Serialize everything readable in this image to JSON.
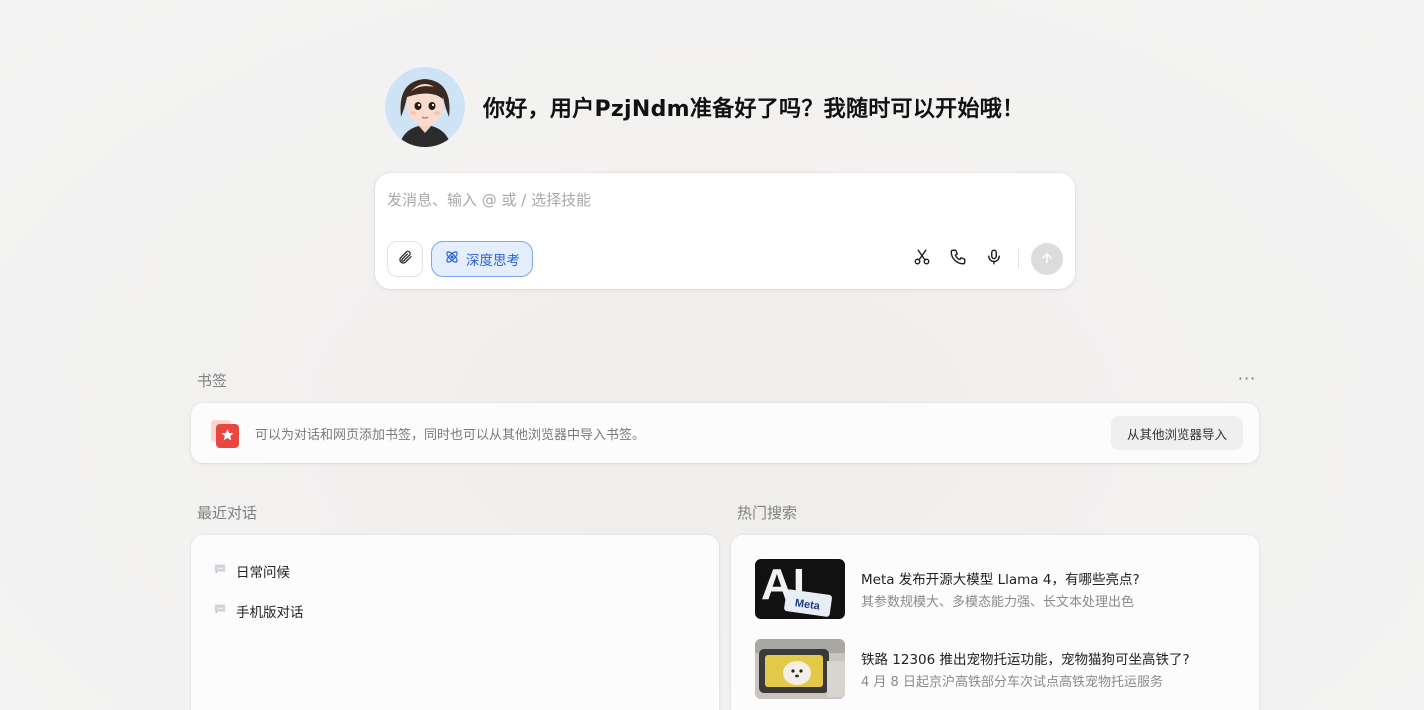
{
  "greeting": "你好，用户PzjNdm准备好了吗？我随时可以开始哦！",
  "composer": {
    "placeholder": "发消息、输入 @ 或 / 选择技能",
    "deep_think_label": "深度思考"
  },
  "icons": {
    "attach": "paperclip-icon",
    "deep_think": "atom-icon",
    "scissors": "scissors-icon",
    "phone": "phone-icon",
    "mic": "microphone-icon",
    "send": "arrow-up-icon",
    "more": "more-icon",
    "bookmark": "star-bookmark-icon",
    "chat": "chat-bubble-icon"
  },
  "bookmarks": {
    "title": "书签",
    "more": "···",
    "hint": "可以为对话和网页添加书签，同时也可以从其他浏览器中导入书签。",
    "import_label": "从其他浏览器导入"
  },
  "recent": {
    "title": "最近对话",
    "items": [
      {
        "label": "日常问候"
      },
      {
        "label": "手机版对话"
      }
    ]
  },
  "hot": {
    "title": "热门搜索",
    "items": [
      {
        "title": "Meta 发布开源大模型 Llama 4，有哪些亮点?",
        "subtitle": "其参数规模大、多模态能力强、长文本处理出色",
        "thumb_text": "AI",
        "thumb_badge": "Meta"
      },
      {
        "title": "铁路 12306 推出宠物托运功能，宠物猫狗可坐高铁了?",
        "subtitle": "4 月 8 日起京沪高铁部分车次试点高铁宠物托运服务"
      }
    ]
  },
  "colors": {
    "accent_blue": "#2a62d4",
    "bookmark_red": "#e8473f",
    "send_disabled": "#dcdcdc"
  }
}
